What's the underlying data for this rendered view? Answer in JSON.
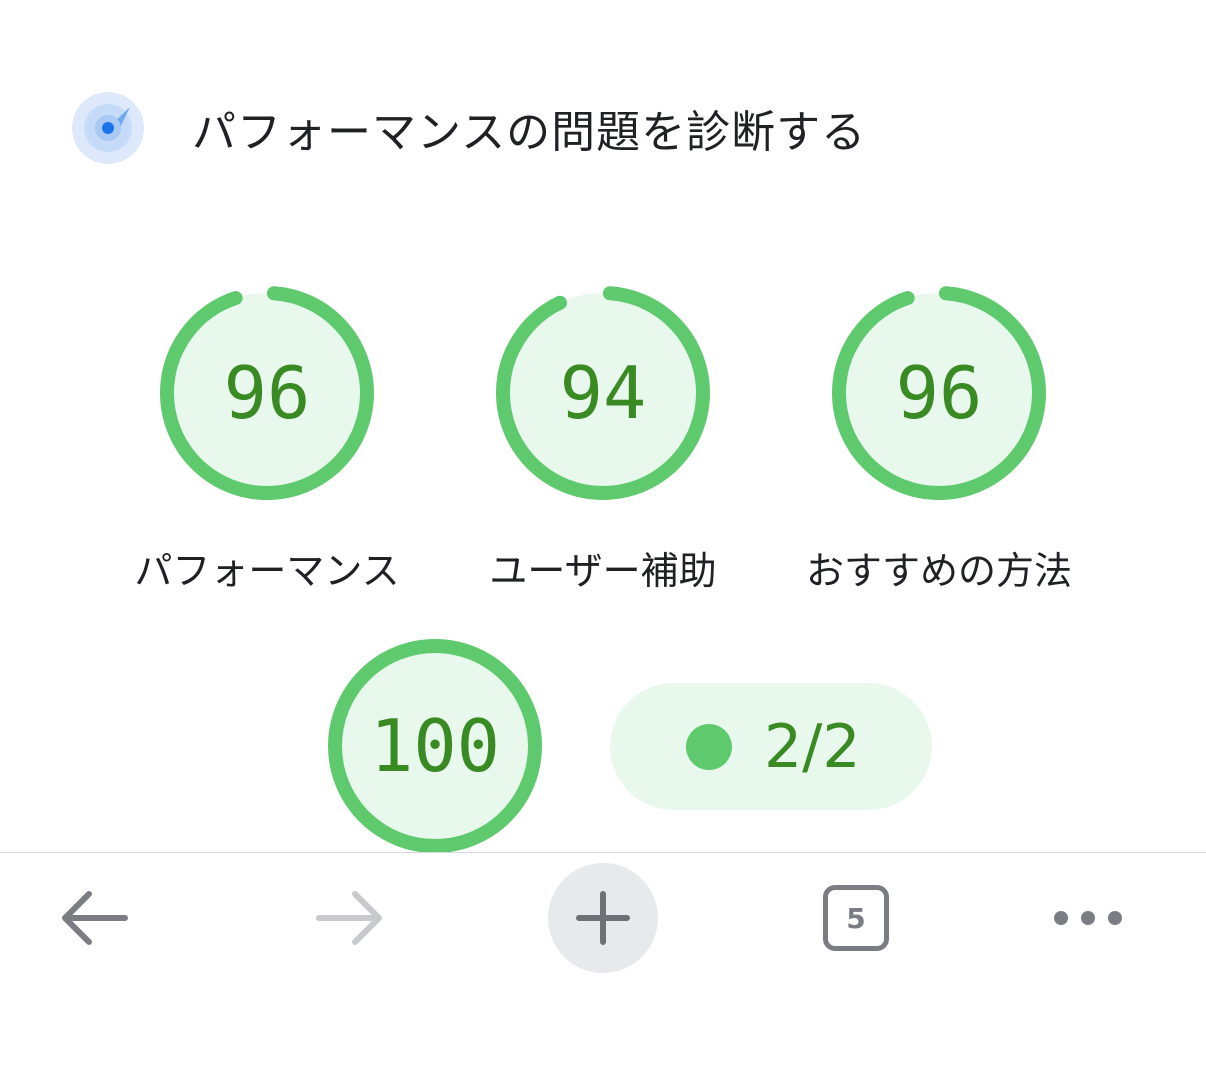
{
  "header": {
    "title": "パフォーマンスの問題を診断する",
    "logo_icon": "lighthouse-icon"
  },
  "scores": [
    {
      "value": "96",
      "label": "パフォーマンス",
      "score": 96
    },
    {
      "value": "94",
      "label": "ユーザー補助",
      "score": 94
    },
    {
      "value": "96",
      "label": "おすすめの方法",
      "score": 96
    },
    {
      "value": "100",
      "label": "",
      "score": 100
    }
  ],
  "pwa": {
    "text": "2/2"
  },
  "toolbar": {
    "back_icon": "back-arrow-icon",
    "forward_icon": "forward-arrow-icon",
    "new_tab_icon": "plus-icon",
    "tab_count": "5",
    "menu_icon": "more-icon"
  },
  "colors": {
    "pass_green": "#5fc96e",
    "pass_text": "#3a8a24",
    "gauge_fill": "#e9f8ec"
  }
}
